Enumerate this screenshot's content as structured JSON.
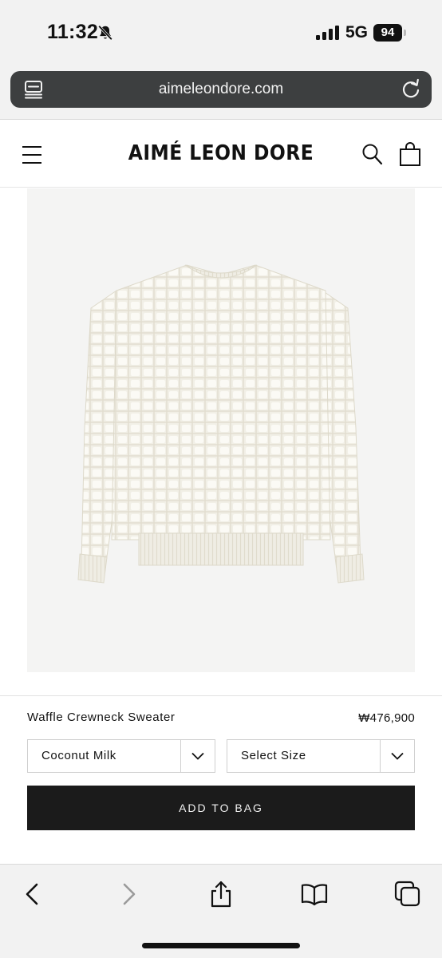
{
  "status_bar": {
    "time": "11:32",
    "network": "5G",
    "battery": "94",
    "icons": [
      "bell-slash-icon",
      "signal-bars-icon",
      "battery-icon"
    ]
  },
  "browser": {
    "url": "aimeleondore.com",
    "icons": [
      "tab-overview-icon",
      "reload-icon"
    ]
  },
  "site_header": {
    "brand": "AIMÉ LEON DORE",
    "icons": [
      "menu-icon",
      "search-icon",
      "bag-icon"
    ]
  },
  "product": {
    "name": "Waffle Crewneck Sweater",
    "price": "₩476,900",
    "image": "sweater-image",
    "color_select": {
      "value": "Coconut Milk"
    },
    "size_select": {
      "value": "Select Size"
    },
    "add_to_bag_label": "ADD TO BAG"
  },
  "toolbar": {
    "icons": [
      "back-icon",
      "forward-icon",
      "share-icon",
      "bookmarks-icon",
      "tabs-icon"
    ]
  },
  "colors": {
    "accent": "#1b1b1b",
    "browser_chrome": "#f2f2f2",
    "url_bar": "#3d3f40",
    "image_bg": "#f4f4f3",
    "sweater": "#f1efe6"
  }
}
